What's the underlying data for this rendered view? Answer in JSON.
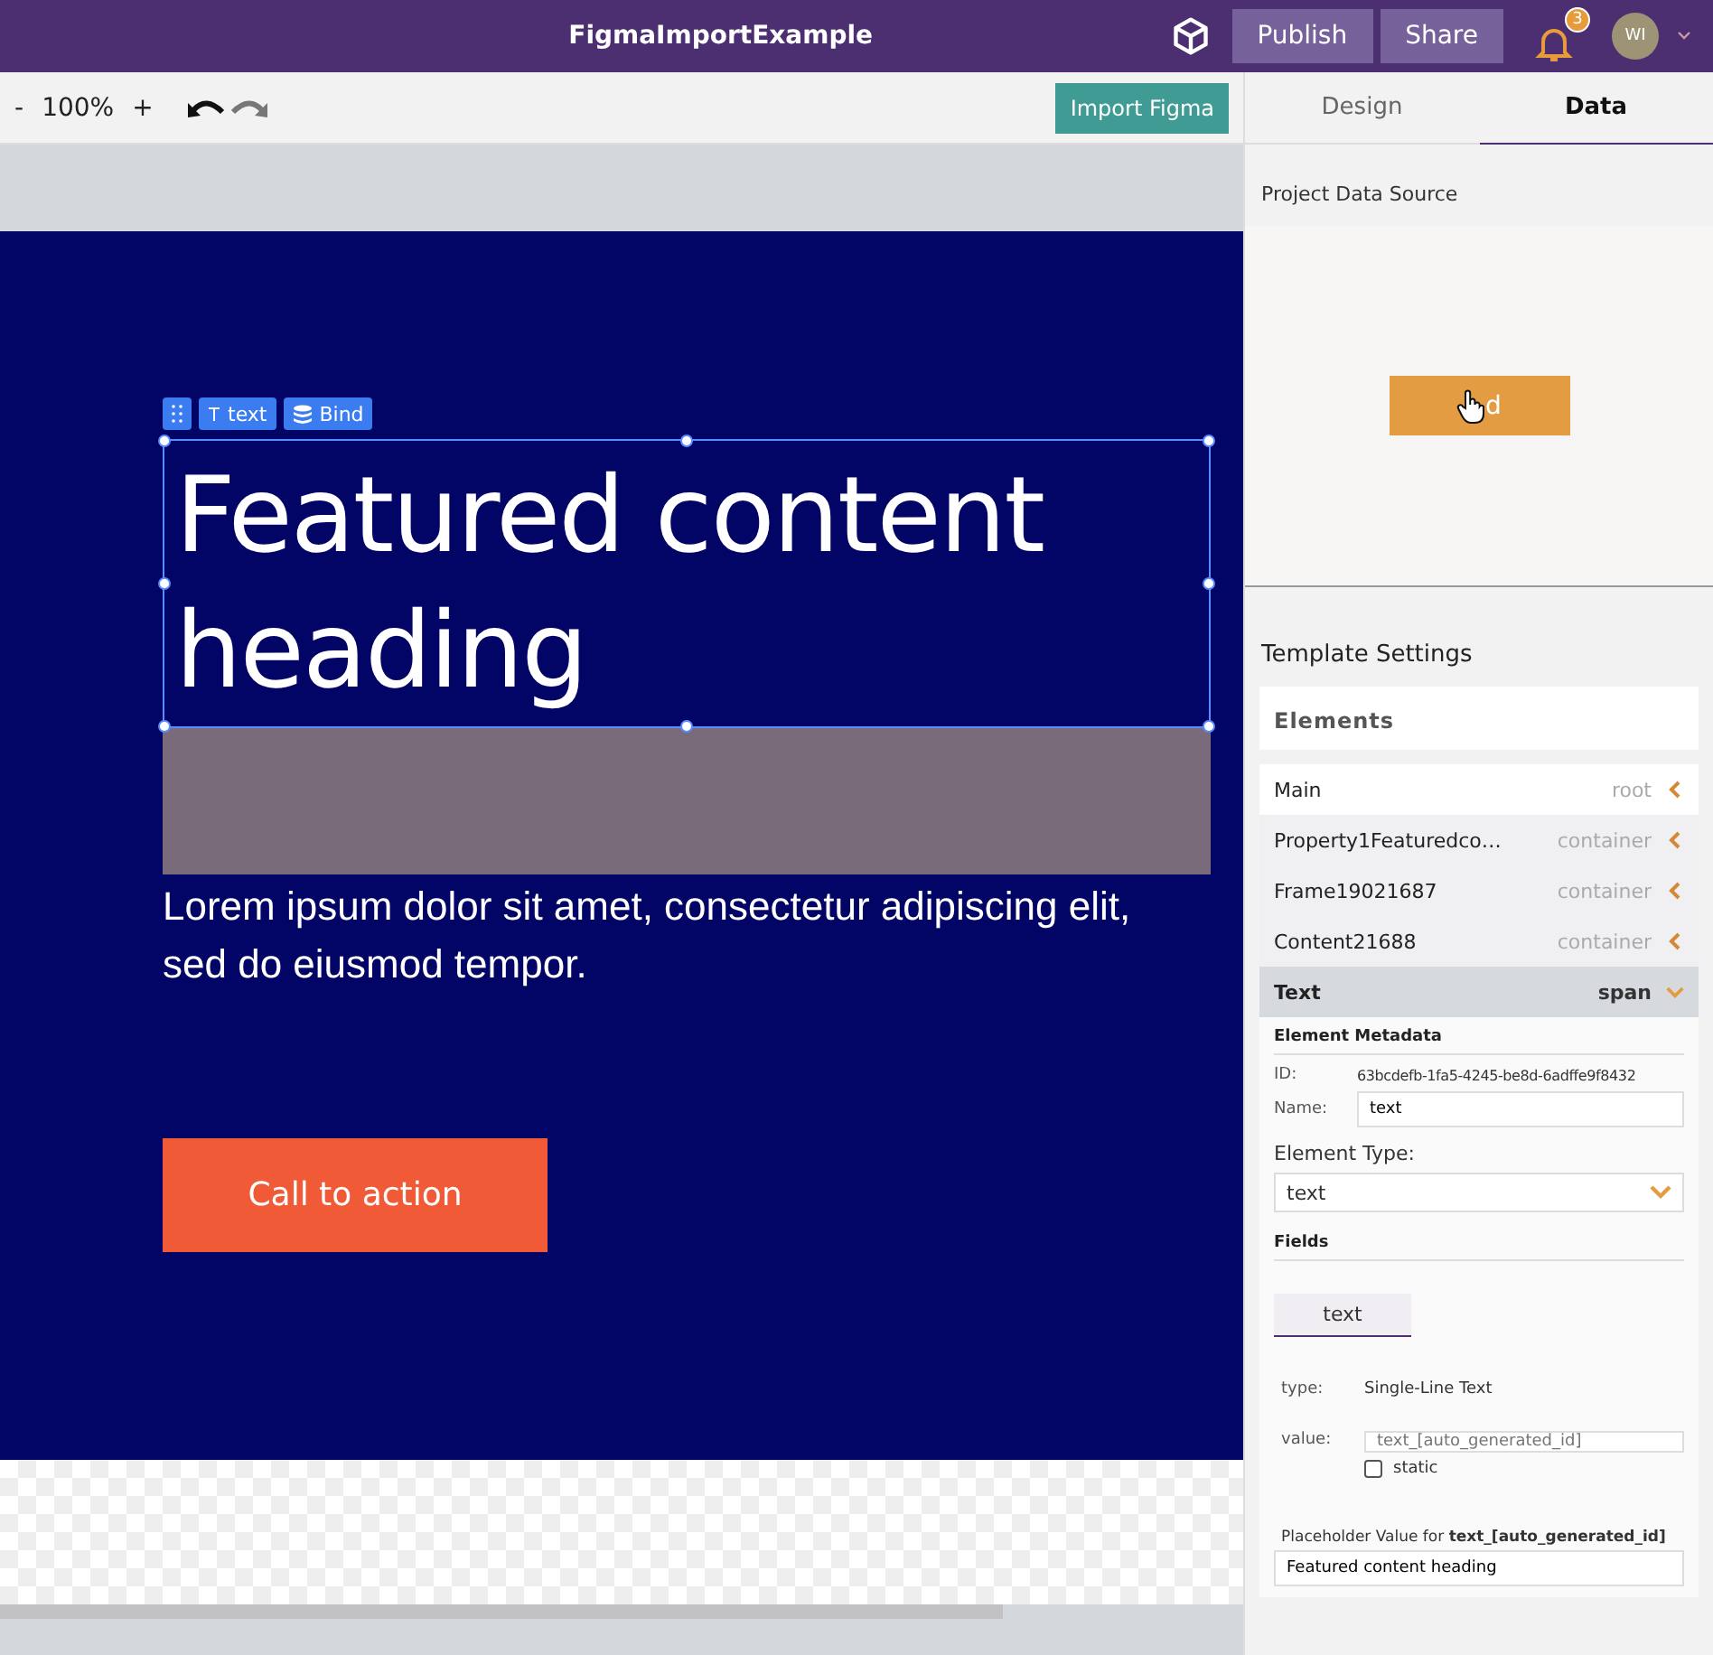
{
  "app": {
    "title": "FigmaImportExample",
    "publish": "Publish",
    "share": "Share",
    "notifications": "3",
    "avatar": "WI"
  },
  "toolbar": {
    "zoom_out": "-",
    "zoom": "100%",
    "zoom_in": "+",
    "import": "Import Figma"
  },
  "panel_tabs": [
    {
      "label": "Design",
      "selected": false
    },
    {
      "label": "Data",
      "selected": true
    }
  ],
  "canvas": {
    "tools": [
      {
        "kind": "drag"
      },
      {
        "kind": "type",
        "label": "text"
      },
      {
        "kind": "bind",
        "label": "Bind"
      }
    ],
    "heading": "Featured content heading",
    "body": "Lorem ipsum dolor sit amet, consectetur adipiscing elit, sed do eiusmod tempor.",
    "cta": "Call to action"
  },
  "data_source": {
    "title": "Project Data Source",
    "button": "d"
  },
  "template": {
    "title": "Template Settings",
    "elements_title": "Elements",
    "elements": [
      {
        "name": "Main",
        "type": "root",
        "selected": false,
        "expanded": false
      },
      {
        "name": "Property1Featuredco…",
        "type": "container",
        "selected": false,
        "expanded": false
      },
      {
        "name": "Frame19021687",
        "type": "container",
        "selected": false,
        "expanded": false
      },
      {
        "name": "Content21688",
        "type": "container",
        "selected": false,
        "expanded": false
      },
      {
        "name": "Text",
        "type": "span",
        "selected": true,
        "expanded": true
      }
    ]
  },
  "metadata": {
    "title": "Element Metadata",
    "id_label": "ID:",
    "id": "63bcdefb-1fa5-4245-be8d-6adffe9f8432",
    "name_label": "Name:",
    "name": "text",
    "type_label": "Element Type:",
    "type": "text"
  },
  "fields": {
    "title": "Fields",
    "tab": "text",
    "type_label": "type:",
    "type": "Single-Line Text",
    "value_label": "value:",
    "value_placeholder": "text_[auto_generated_id]",
    "static_label": "static",
    "static_checked": false,
    "default_text": {
      "label": "Placeholder Value for ",
      "key": "text_[auto_generated_id]",
      "value": "Featured content heading"
    }
  }
}
